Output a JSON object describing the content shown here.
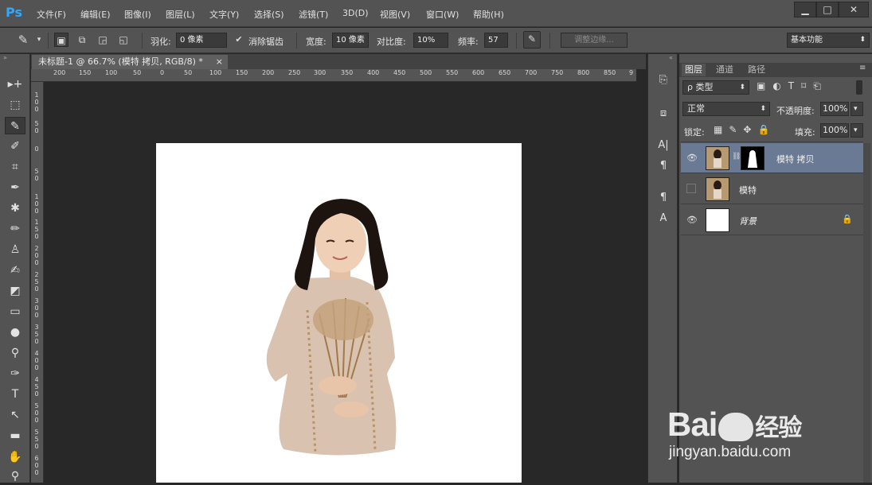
{
  "app": {
    "logo": "Ps"
  },
  "menu": [
    "文件(F)",
    "编辑(E)",
    "图像(I)",
    "图层(L)",
    "文字(Y)",
    "选择(S)",
    "滤镜(T)",
    "3D(D)",
    "视图(V)",
    "窗口(W)",
    "帮助(H)"
  ],
  "window_controls": {
    "minimize": "▁",
    "maximize": "□",
    "close": "✕"
  },
  "options": {
    "feather_label": "羽化:",
    "feather_value": "0 像素",
    "antialias_label": "消除锯齿",
    "width_label": "宽度:",
    "width_value": "10 像素",
    "contrast_label": "对比度:",
    "contrast_value": "10%",
    "frequency_label": "频率:",
    "frequency_value": "57",
    "refine_edge": "调整边缘...",
    "workspace": "基本功能"
  },
  "document": {
    "tab_title": "未标题-1 @ 66.7% (模特 拷贝, RGB/8) *",
    "close": "×"
  },
  "ruler": {
    "h_ticks": [
      "200",
      "150",
      "100",
      "50",
      "0",
      "50",
      "100",
      "150",
      "200",
      "250",
      "300",
      "350",
      "400",
      "450",
      "500",
      "550",
      "600",
      "650",
      "700",
      "750",
      "800",
      "850",
      "9"
    ],
    "v_ticks": [
      "1\n0\n0",
      "5\n0",
      "0",
      "5\n0",
      "1\n0\n0",
      "1\n5\n0",
      "2\n0\n0",
      "2\n5\n0",
      "3\n0\n0",
      "3\n5\n0",
      "4\n0\n0",
      "4\n5\n0",
      "5\n0\n0",
      "5\n5\n0",
      "6\n0\n0"
    ]
  },
  "layers_panel": {
    "tabs": [
      "图层",
      "通道",
      "路径"
    ],
    "filter_kind": "ρ 类型",
    "blend_mode": "正常",
    "opacity_label": "不透明度:",
    "opacity_value": "100%",
    "lock_label": "锁定:",
    "fill_label": "填充:",
    "fill_value": "100%",
    "layers": [
      {
        "name": "模特 拷贝",
        "visible": true,
        "selected": true,
        "has_mask": true
      },
      {
        "name": "模特",
        "visible": false,
        "selected": false,
        "has_mask": false
      },
      {
        "name": "背景",
        "visible": true,
        "selected": false,
        "locked": true
      }
    ]
  },
  "watermark": {
    "brand": "Bai",
    "brand2": "经验",
    "url": "jingyan.baidu.com"
  },
  "colors": {
    "accent": "#31a8ff",
    "selected_layer": "#6a7a94",
    "panel": "#535353",
    "workspace": "#282828"
  }
}
